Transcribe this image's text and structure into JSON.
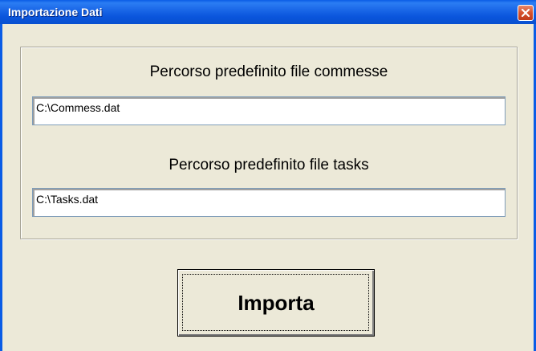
{
  "window": {
    "title": "Importazione Dati"
  },
  "form": {
    "commesse_label": "Percorso predefinito file commesse",
    "commesse_value": "C:\\Commess.dat",
    "tasks_label": "Percorso predefinito file tasks",
    "tasks_value": "C:\\Tasks.dat"
  },
  "actions": {
    "import_label": "Importa"
  },
  "icons": {
    "close": "close-icon"
  },
  "colors": {
    "titlebar": "#0a5ce6",
    "close_button": "#d5512d",
    "window_background": "#ece9d8"
  }
}
